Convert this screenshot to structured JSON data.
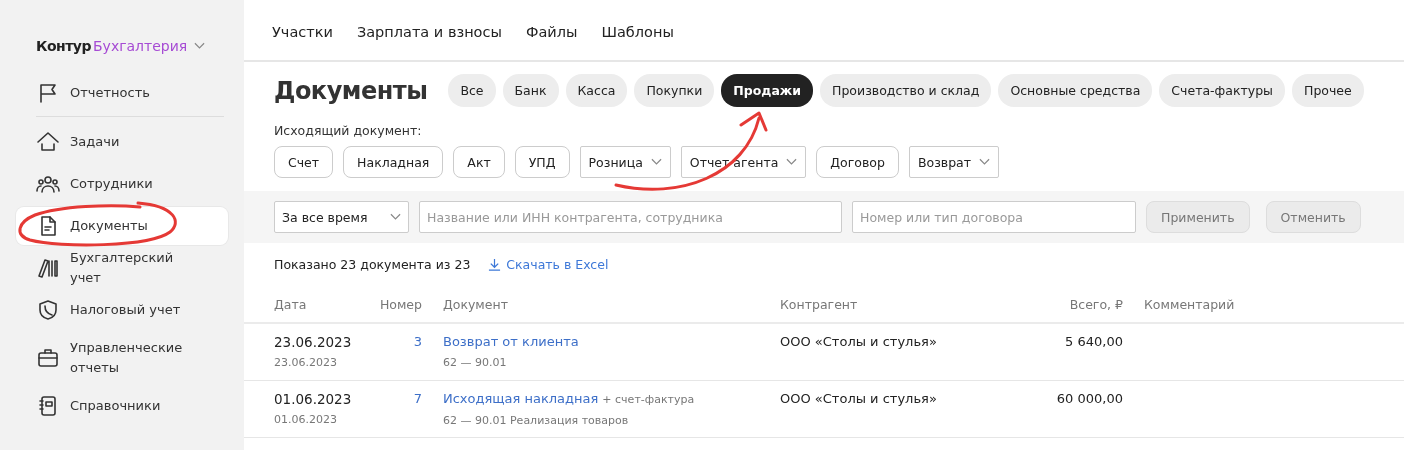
{
  "sidebar": {
    "logo": {
      "brand": "Контур",
      "product": "Бухгалтерия"
    },
    "items": [
      {
        "label": "Отчетность",
        "selected": false
      },
      {
        "label": "Задачи",
        "selected": false
      },
      {
        "label": "Сотрудники",
        "selected": false
      },
      {
        "label": "Документы",
        "selected": true
      },
      {
        "label": "Бухгалтерский учет",
        "selected": false
      },
      {
        "label": "Налоговый учет",
        "selected": false
      },
      {
        "label": "Управленческие отчеты",
        "selected": false
      },
      {
        "label": "Справочники",
        "selected": false
      }
    ]
  },
  "top_tabs": [
    "Участки",
    "Зарплата и взносы",
    "Файлы",
    "Шаблоны"
  ],
  "page_title": "Документы",
  "categories": [
    {
      "label": "Все",
      "selected": false
    },
    {
      "label": "Банк",
      "selected": false
    },
    {
      "label": "Касса",
      "selected": false
    },
    {
      "label": "Покупки",
      "selected": false
    },
    {
      "label": "Продажи",
      "selected": true
    },
    {
      "label": "Производство и склад",
      "selected": false
    },
    {
      "label": "Основные средства",
      "selected": false
    },
    {
      "label": "Счета-фактуры",
      "selected": false
    },
    {
      "label": "Прочее",
      "selected": false
    }
  ],
  "outgoing": {
    "label": "Исходящий документ:",
    "buttons": [
      {
        "label": "Счет",
        "kind": "button"
      },
      {
        "label": "Накладная",
        "kind": "button"
      },
      {
        "label": "Акт",
        "kind": "button"
      },
      {
        "label": "УПД",
        "kind": "button"
      },
      {
        "label": "Розница",
        "kind": "dropdown"
      },
      {
        "label": "Отчет агента",
        "kind": "dropdown"
      },
      {
        "label": "Договор",
        "kind": "button"
      },
      {
        "label": "Возврат",
        "kind": "dropdown"
      }
    ]
  },
  "filters": {
    "period": "За все время",
    "search": {
      "placeholder": "Название или ИНН контрагента, сотрудника"
    },
    "contract": {
      "placeholder": "Номер или тип договора"
    },
    "buttons": [
      {
        "label": "Применить",
        "disabled": true
      },
      {
        "label": "Отменить",
        "disabled": true
      }
    ]
  },
  "summary": {
    "text": "Показано 23 документа из 23",
    "download": "Скачать в Excel"
  },
  "table": {
    "columns": [
      "Дата",
      "Номер",
      "Документ",
      "Контрагент",
      "Всего, ₽",
      "Комментарий"
    ],
    "rows": [
      {
        "date": "23.06.2023",
        "date_sub": "23.06.2023",
        "number": "3",
        "document": "Возврат от клиента",
        "accounts": "62 — 90.01",
        "counterparty": "ООО «Столы и стулья»",
        "total": "5 640,00"
      },
      {
        "date": "01.06.2023",
        "date_sub": "01.06.2023",
        "number": "7",
        "document": "Исходящая накладная",
        "document_extra": "+ счет-фактура",
        "accounts": "62 — 90.01 Реализация товаров",
        "counterparty": "ООО «Столы и стулья»",
        "total": "60 000,00"
      }
    ]
  }
}
